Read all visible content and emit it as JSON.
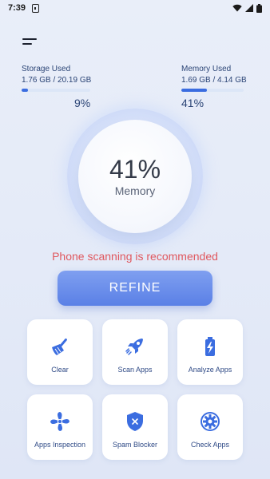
{
  "status_bar": {
    "time": "7:39"
  },
  "colors": {
    "accent": "#3b6de0",
    "warning": "#e0585f",
    "button": "#6a8ceb"
  },
  "storage": {
    "title": "Storage Used",
    "value": "1.76 GB / 20.19 GB",
    "percent": "9%",
    "fraction": 0.09
  },
  "memory": {
    "title": "Memory Used",
    "value": "1.69 GB / 4.14 GB",
    "percent": "41%",
    "fraction": 0.41
  },
  "gauge": {
    "value": "41%",
    "label": "Memory"
  },
  "recommendation": "Phone scanning is recommended",
  "refine_label": "REFINE",
  "tiles": [
    {
      "label": "Clear",
      "icon": "broom-icon"
    },
    {
      "label": "Scan Apps",
      "icon": "rocket-icon"
    },
    {
      "label": "Analyze Apps",
      "icon": "battery-charging-icon"
    },
    {
      "label": "Apps Inspection",
      "icon": "fan-icon"
    },
    {
      "label": "Spam Blocker",
      "icon": "shield-x-icon"
    },
    {
      "label": "Check Apps",
      "icon": "gear-icon"
    }
  ]
}
